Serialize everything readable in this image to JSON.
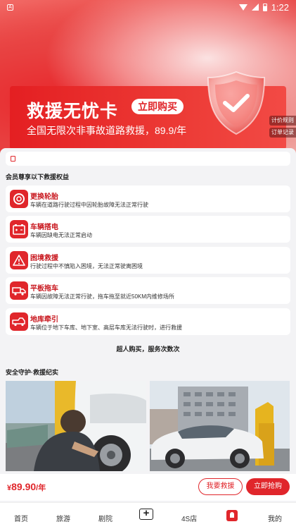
{
  "status_bar": {
    "app_icon": "A",
    "time": "1:22"
  },
  "banner": {
    "title": "救援无忧卡",
    "buy_chip": "立即购买",
    "subtitle": "全国无限次非事故道路救援，89.9/年",
    "side_tags": [
      "计价规则",
      "订单记录"
    ]
  },
  "benefits": {
    "section_title": "会员尊享以下救援权益",
    "items": [
      {
        "title": "更换轮胎",
        "desc": "车辆在道路行驶过程中因轮胎故障无法正常行驶",
        "icon": "tire-icon"
      },
      {
        "title": "车辆搭电",
        "desc": "车辆因缺电无法正常启动",
        "icon": "battery-icon"
      },
      {
        "title": "困境救援",
        "desc": "行驶过程中不慎陷入困境，无法正常驶离困境",
        "icon": "warning-icon"
      },
      {
        "title": "平板拖车",
        "desc": "车辆因故障无法正常行驶，拖车拖至就近50KM内维修场所",
        "icon": "flatbed-truck-icon"
      },
      {
        "title": "地库牵引",
        "desc": "车辆位于地下车库、地下室、高层车库无法行驶时，进行救援",
        "icon": "tow-truck-icon"
      }
    ],
    "slogan": "超人购买，服务次数次"
  },
  "records": {
    "section_title": "安全守护·救援纪实"
  },
  "purchase": {
    "price_currency": "¥",
    "price_value": "89.90",
    "price_unit": "/年",
    "rescue_button": "我要救援",
    "buy_button": "立即抢购"
  },
  "tabbar": {
    "items": [
      "首页",
      "旅游",
      "剧院",
      "4S店",
      "我的"
    ]
  },
  "colors": {
    "brand_red": "#e0262b",
    "title_red": "#c8161d"
  }
}
